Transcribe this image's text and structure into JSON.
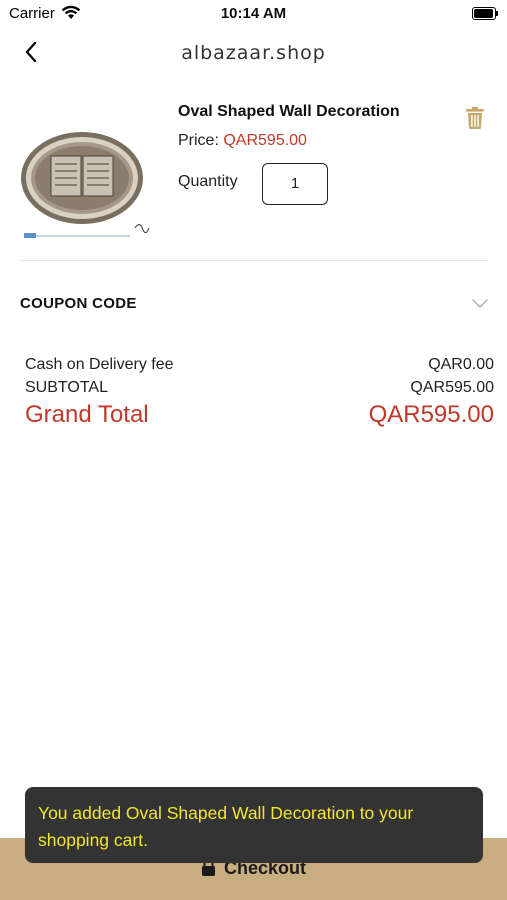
{
  "status_bar": {
    "carrier": "Carrier",
    "time": "10:14 AM"
  },
  "header": {
    "brand": "albazaar.shop"
  },
  "cart_item": {
    "name": "Oval Shaped Wall Decoration",
    "price_label": "Price: ",
    "price_value": "QAR595.00",
    "quantity_label": "Quantity",
    "quantity_value": "1"
  },
  "coupon": {
    "label": "COUPON CODE"
  },
  "totals": {
    "cod_label": "Cash on Delivery fee",
    "cod_value": "QAR0.00",
    "subtotal_label": "SUBTOTAL",
    "subtotal_value": "QAR595.00",
    "grand_label": "Grand Total",
    "grand_value": "QAR595.00"
  },
  "checkout": {
    "label": "Checkout"
  },
  "toast": {
    "message": "You added Oval Shaped Wall Decoration  to your shopping cart."
  },
  "colors": {
    "accent_red": "#c0392b",
    "checkout_tan": "#c7ad7f",
    "toast_bg": "#333333",
    "toast_text": "#f2e62e",
    "trash_gold": "#c6a96a"
  },
  "icons": [
    "back-chevron-icon",
    "trash-icon",
    "chevron-down-icon",
    "lock-icon",
    "wifi-icon",
    "battery-icon"
  ]
}
